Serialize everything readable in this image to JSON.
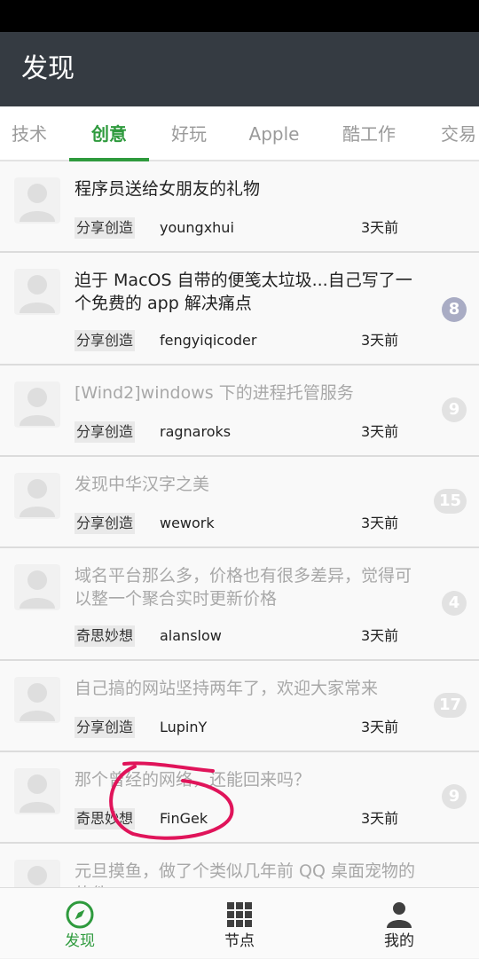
{
  "app": {
    "title": "发现"
  },
  "tabs": [
    {
      "label": "技术",
      "active": false
    },
    {
      "label": "创意",
      "active": true
    },
    {
      "label": "好玩",
      "active": false
    },
    {
      "label": "Apple",
      "active": false
    },
    {
      "label": "酷工作",
      "active": false
    },
    {
      "label": "交易",
      "active": false
    }
  ],
  "topics": [
    {
      "title": "程序员送给女朋友的礼物",
      "node": "分享创造",
      "author": "youngxhui",
      "time": "3天前",
      "replies": "",
      "read": false
    },
    {
      "title": "迫于 MacOS 自带的便笺太垃圾...自己写了一个免费的 app 解决痛点",
      "node": "分享创造",
      "author": "fengyiqicoder",
      "time": "3天前",
      "replies": "8",
      "read": false
    },
    {
      "title": "[Wind2]windows 下的进程托管服务",
      "node": "分享创造",
      "author": "ragnaroks",
      "time": "3天前",
      "replies": "9",
      "read": true
    },
    {
      "title": "发现中华汉字之美",
      "node": "分享创造",
      "author": "wework",
      "time": "3天前",
      "replies": "15",
      "read": true
    },
    {
      "title": "域名平台那么多，价格也有很多差异，觉得可以整一个聚合实时更新价格",
      "node": "奇思妙想",
      "author": "alanslow",
      "time": "3天前",
      "replies": "4",
      "read": true
    },
    {
      "title": "自己搞的网站坚持两年了，欢迎大家常来",
      "node": "分享创造",
      "author": "LupinY",
      "time": "3天前",
      "replies": "17",
      "read": true
    },
    {
      "title": "那个曾经的网络，还能回来吗？",
      "node": "奇思妙想",
      "author": "FinGek",
      "time": "3天前",
      "replies": "9",
      "read": true
    },
    {
      "title": "元旦摸鱼，做了个类似几年前 QQ 桌面宠物的软件",
      "node": "",
      "author": "",
      "time": "",
      "replies": "",
      "read": true
    }
  ],
  "bottom_nav": [
    {
      "label": "发现",
      "icon": "compass-icon",
      "active": true
    },
    {
      "label": "节点",
      "icon": "grid-icon",
      "active": false
    },
    {
      "label": "我的",
      "icon": "person-icon",
      "active": false
    }
  ],
  "colors": {
    "accent": "#2e9a3d",
    "appbar": "#353b42",
    "annotation": "#e0145a"
  }
}
